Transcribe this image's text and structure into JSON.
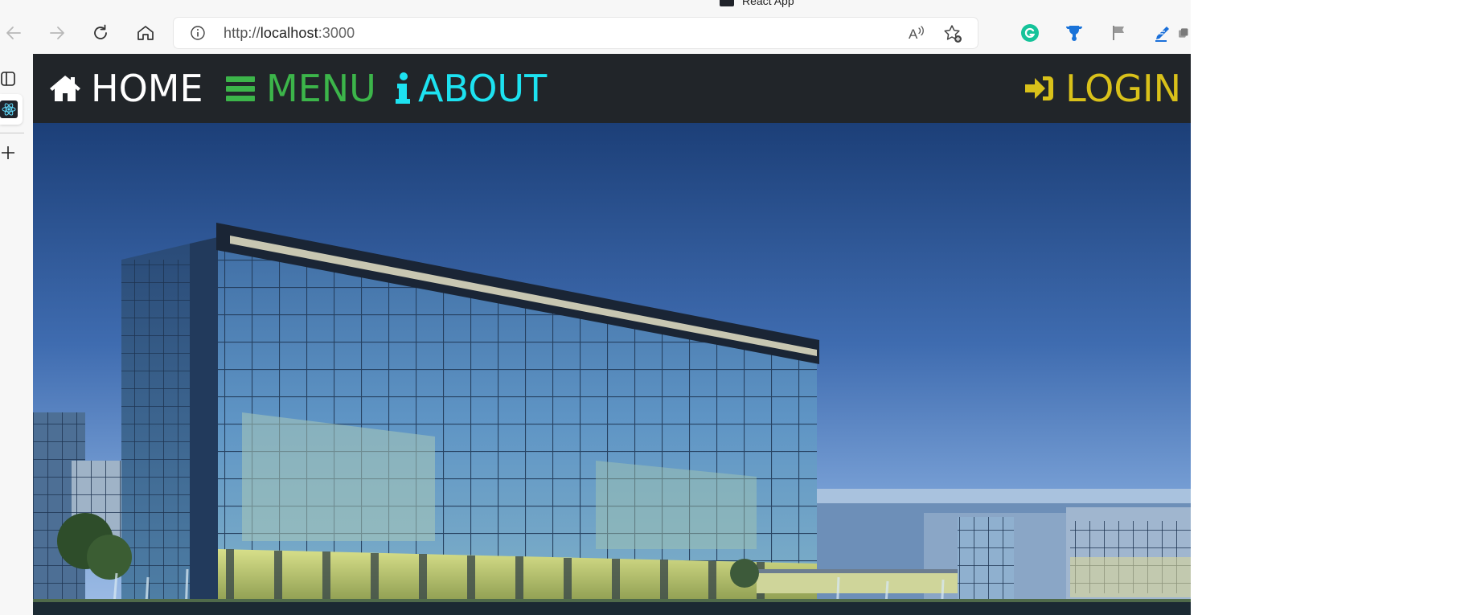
{
  "browser": {
    "tab_title": "React App",
    "address_bar": {
      "url_scheme": "http://",
      "url_host": "localhost",
      "url_port": ":3000"
    }
  },
  "navbar": {
    "home": {
      "label": "HOME",
      "icon": "home-icon",
      "color": "#ffffff"
    },
    "menu": {
      "label": "MENU",
      "icon": "bars-icon",
      "color": "#3cb54a"
    },
    "about": {
      "label": "ABOUT",
      "icon": "info-icon",
      "color": "#1de2f0"
    },
    "login": {
      "label": "LOGIN",
      "icon": "sign-in-icon",
      "color": "#d9c11a"
    },
    "background": "#212529"
  },
  "hero": {
    "image": "modern glass office building at dusk"
  },
  "extensions": [
    "grammarly-icon",
    "trophy-icon",
    "flag-icon",
    "pen-icon",
    "collections-icon"
  ]
}
